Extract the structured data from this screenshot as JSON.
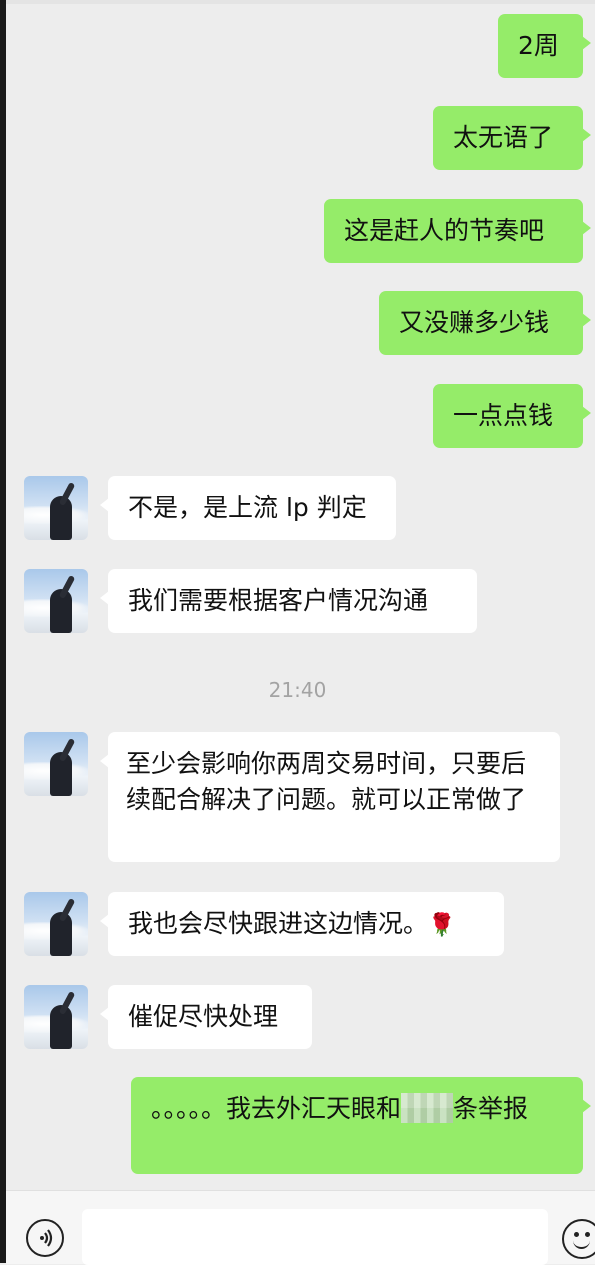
{
  "messages": [
    {
      "side": "out",
      "text": "2周"
    },
    {
      "side": "out",
      "text": "太无语了"
    },
    {
      "side": "out",
      "text": "这是赶人的节奏吧"
    },
    {
      "side": "out",
      "text": "又没赚多少钱"
    },
    {
      "side": "out",
      "text": "一点点钱"
    },
    {
      "side": "in",
      "text": "不是，是上流 lp 判定"
    },
    {
      "side": "in",
      "text": "我们需要根据客户情况沟通"
    },
    {
      "side": "in",
      "text": "至少会影响你两周交易时间，只要后续配合解决了问题。就可以正常做了"
    },
    {
      "side": "in",
      "text": "我也会尽快跟进这边情况。",
      "emoji": "🌹"
    },
    {
      "side": "in",
      "text": "催促尽快处理"
    },
    {
      "side": "out",
      "text_before": "。。。。。我去外汇天眼和",
      "text_after": "条举报"
    }
  ],
  "timestamp": "21:40",
  "icons": {
    "avatar": "contact-avatar",
    "voice": "voice-icon",
    "emoji": "emoji-icon",
    "emoji_in_message": "rose-icon"
  },
  "colors": {
    "background": "#ededed",
    "outgoing_bubble": "#95ec69",
    "incoming_bubble": "#ffffff",
    "timestamp_text": "#a3a3a3"
  }
}
